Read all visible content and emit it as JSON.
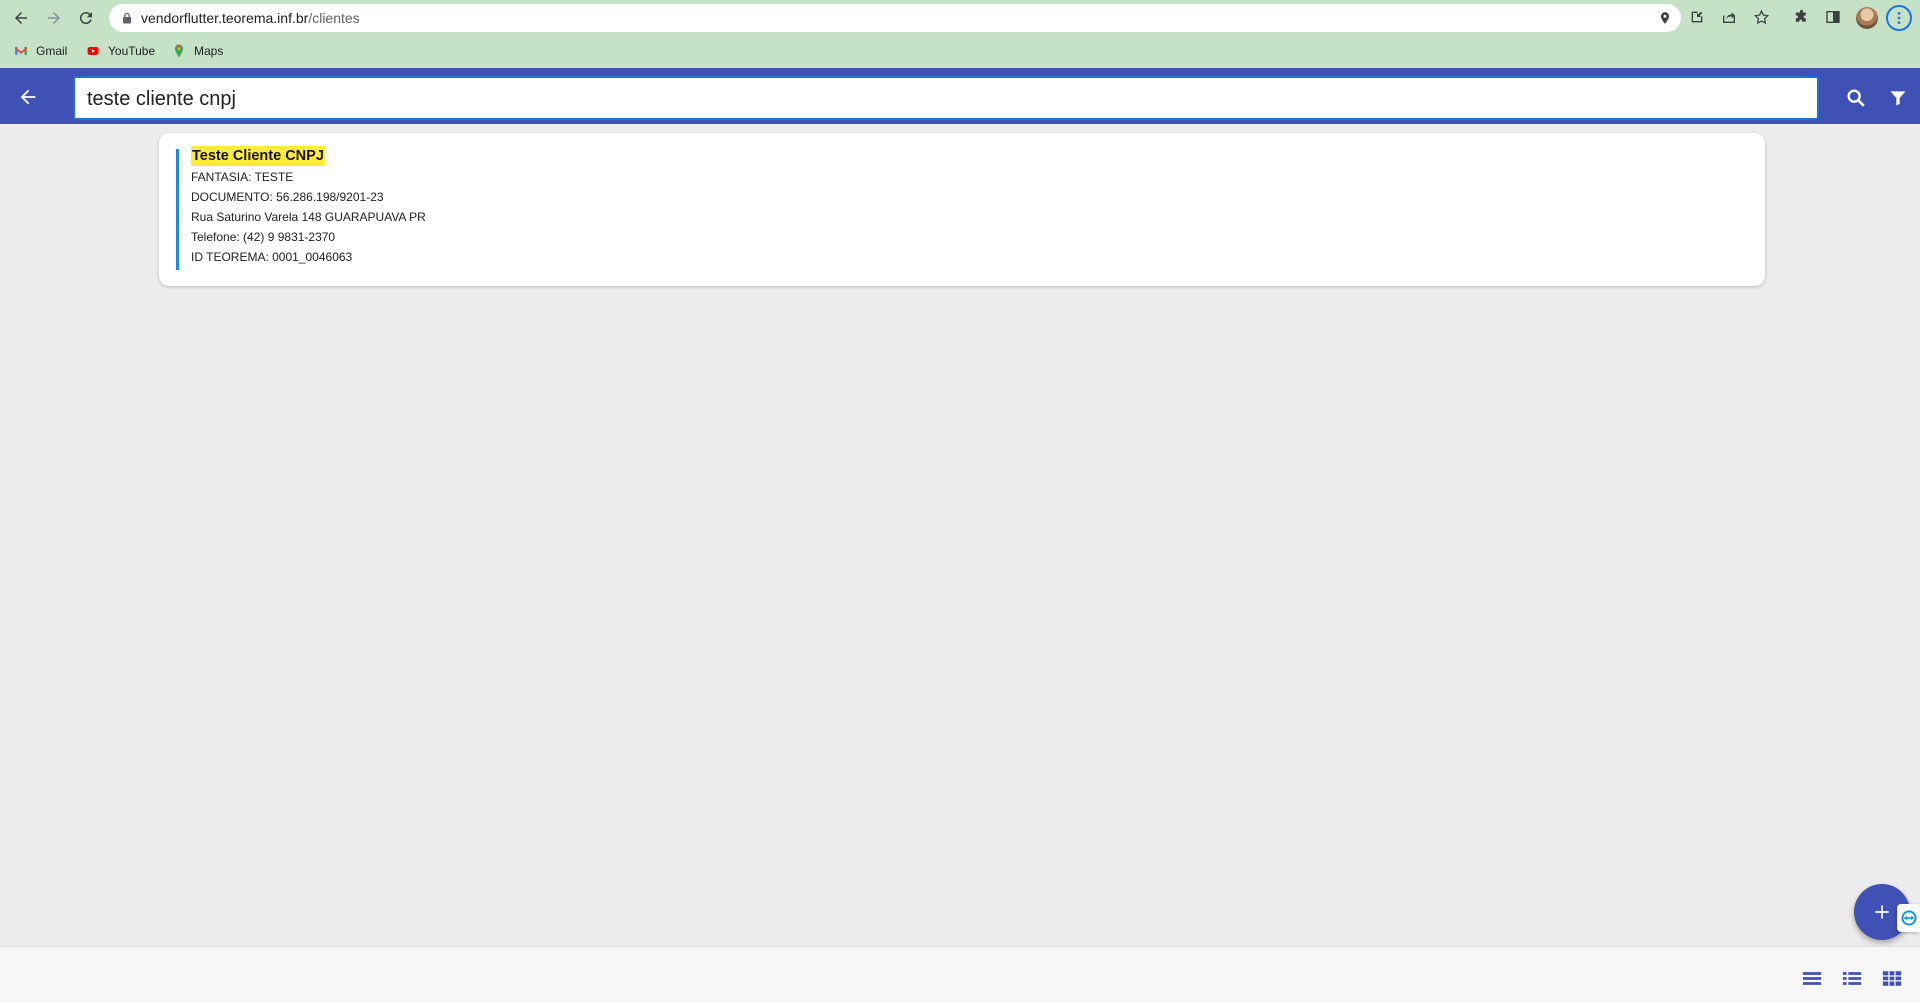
{
  "browser": {
    "url_host": "vendorflutter.teorema.inf.br",
    "url_path": "/clientes",
    "bookmarks": [
      {
        "label": "Gmail",
        "icon": "gmail-icon"
      },
      {
        "label": "YouTube",
        "icon": "youtube-icon"
      },
      {
        "label": "Maps",
        "icon": "maps-icon"
      }
    ]
  },
  "appbar": {
    "search_value": "teste cliente cnpj",
    "color": "#3f51b5"
  },
  "results": [
    {
      "name": "Teste Cliente CNPJ",
      "fantasia": "FANTASIA: TESTE",
      "documento": "DOCUMENTO: 56.286.198/9201-23",
      "endereco": "Rua Saturino Varela 148 GUARAPUAVA PR",
      "telefone": "Telefone: (42) 9 9831-2370",
      "id_teorema": "ID TEOREMA: 0001_0046063"
    }
  ],
  "colors": {
    "accent": "#3f51b5",
    "highlight": "#ffeb3b",
    "card_border": "#1e88e5"
  }
}
